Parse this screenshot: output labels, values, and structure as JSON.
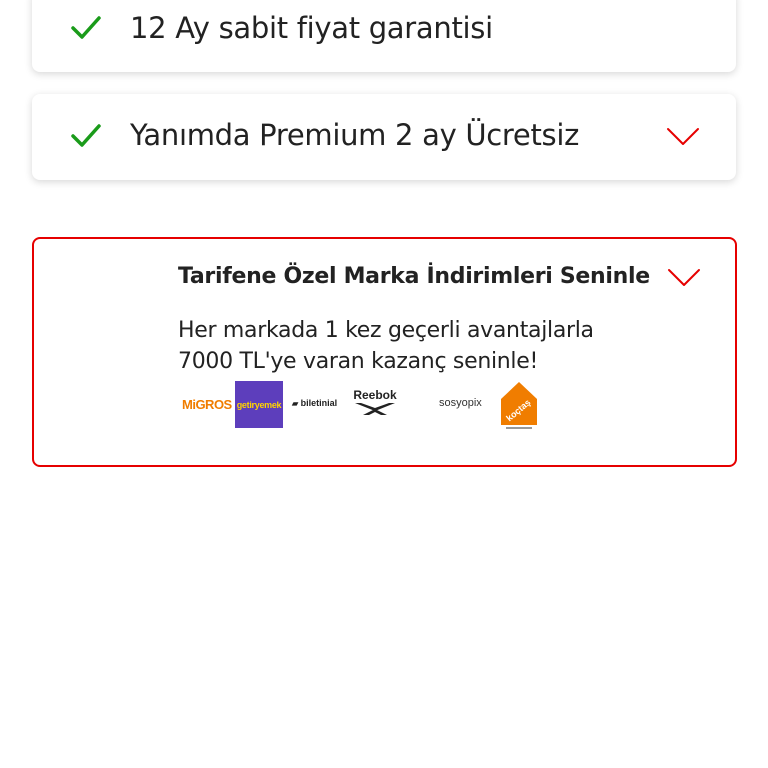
{
  "colors": {
    "accent": "#e60000",
    "check": "#1a9b1a",
    "text": "#222222"
  },
  "features": [
    {
      "label": "12 Ay sabit fiyat garantisi",
      "icon": "check-icon"
    },
    {
      "label": "Yanımda Premium 2 ay Ücretsiz",
      "icon": "check-icon",
      "expand_icon": "chevron-down-icon"
    }
  ],
  "promo": {
    "title": "Tarifene Özel Marka İndirimleri Seninle",
    "description_lines": [
      "Her markada 1 kez geçerli avantajlarla",
      "7000 TL'ye varan kazanç seninle!"
    ],
    "expand_icon": "chevron-down-icon",
    "brands": {
      "migros": "MiGROS",
      "getir": "getiryemek",
      "biletinial": "biletinial",
      "reebok": "Reebok",
      "sosyopix": "sosyopix",
      "koctas": "koçtaş"
    }
  }
}
